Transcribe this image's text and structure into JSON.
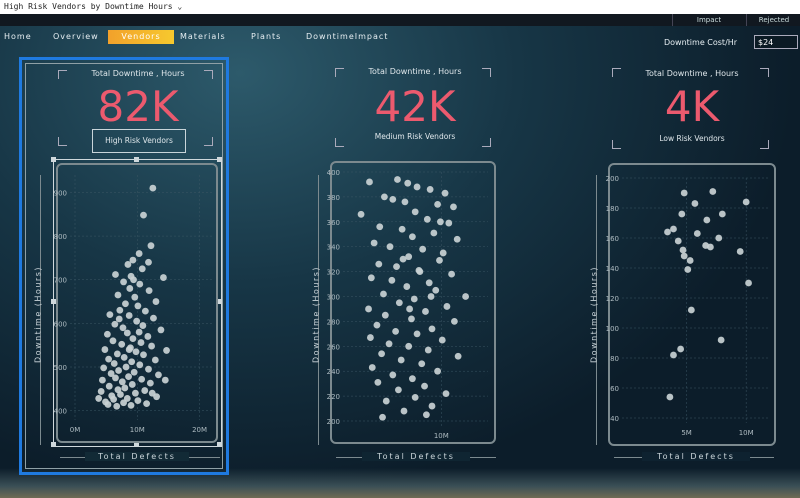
{
  "window": {
    "title": "High Risk Vendors by Downtime Hours",
    "tabs": [
      {
        "label": "Impact"
      },
      {
        "label": "Rejected"
      }
    ]
  },
  "nav": {
    "items": [
      {
        "label": "Home"
      },
      {
        "label": "Overview"
      },
      {
        "label": "Vendors"
      },
      {
        "label": "Materials"
      },
      {
        "label": "Plants"
      },
      {
        "label": "DowntimeImpact"
      }
    ],
    "active": "Vendors"
  },
  "cost": {
    "label": "Downtime Cost/Hr",
    "value": "$24"
  },
  "kpis": [
    {
      "title": "Total Downtime , Hours",
      "value": "82K",
      "subtitle": "High Risk Vendors"
    },
    {
      "title": "Total Downtime , Hours",
      "value": "42K",
      "subtitle": "Medium Risk Vendors"
    },
    {
      "title": "Total Downtime , Hours",
      "value": "4K",
      "subtitle": "Low Risk Vendors"
    }
  ],
  "colors": {
    "accent_nav": "#f2a12b",
    "kpi_value": "#ec5a6e",
    "selection": "#1f7ae0",
    "points": "#c9d1d4"
  },
  "chart_data": [
    {
      "type": "scatter",
      "title": "",
      "xlabel": "Total Defects",
      "ylabel": "Downtime (Hours)",
      "xlim": [
        0,
        22000000
      ],
      "ylim": [
        390,
        940
      ],
      "xticks": [
        "0M",
        "10M",
        "20M"
      ],
      "yticks": [
        "400",
        "500",
        "600",
        "700",
        "800",
        "900"
      ],
      "points": [
        [
          12500000,
          910
        ],
        [
          11000000,
          848
        ],
        [
          12200000,
          778
        ],
        [
          10300000,
          760
        ],
        [
          9300000,
          745
        ],
        [
          8500000,
          735
        ],
        [
          10800000,
          725
        ],
        [
          6500000,
          712
        ],
        [
          9000000,
          708
        ],
        [
          14200000,
          705
        ],
        [
          7800000,
          695
        ],
        [
          10400000,
          690
        ],
        [
          8800000,
          680
        ],
        [
          11900000,
          675
        ],
        [
          6900000,
          665
        ],
        [
          9600000,
          660
        ],
        [
          13000000,
          650
        ],
        [
          8100000,
          645
        ],
        [
          10100000,
          640
        ],
        [
          7200000,
          630
        ],
        [
          11300000,
          628
        ],
        [
          5600000,
          620
        ],
        [
          8700000,
          618
        ],
        [
          12600000,
          612
        ],
        [
          9900000,
          605
        ],
        [
          6400000,
          598
        ],
        [
          10900000,
          595
        ],
        [
          7700000,
          590
        ],
        [
          13800000,
          585
        ],
        [
          8400000,
          578
        ],
        [
          5200000,
          575
        ],
        [
          11700000,
          570
        ],
        [
          9300000,
          565
        ],
        [
          6100000,
          560
        ],
        [
          10600000,
          556
        ],
        [
          7500000,
          552
        ],
        [
          12300000,
          548
        ],
        [
          8900000,
          544
        ],
        [
          4800000,
          540
        ],
        [
          14700000,
          538
        ],
        [
          9800000,
          535
        ],
        [
          6800000,
          530
        ],
        [
          11000000,
          528
        ],
        [
          7900000,
          522
        ],
        [
          5400000,
          518
        ],
        [
          12900000,
          516
        ],
        [
          9100000,
          512
        ],
        [
          6300000,
          508
        ],
        [
          10400000,
          505
        ],
        [
          8200000,
          500
        ],
        [
          4600000,
          498
        ],
        [
          11800000,
          495
        ],
        [
          7000000,
          492
        ],
        [
          9500000,
          488
        ],
        [
          5800000,
          485
        ],
        [
          13400000,
          482
        ],
        [
          8600000,
          478
        ],
        [
          6500000,
          475
        ],
        [
          10700000,
          472
        ],
        [
          4400000,
          470
        ],
        [
          7600000,
          466
        ],
        [
          12100000,
          463
        ],
        [
          9200000,
          460
        ],
        [
          5500000,
          456
        ],
        [
          8000000,
          452
        ],
        [
          6900000,
          448
        ],
        [
          11200000,
          446
        ],
        [
          4200000,
          444
        ],
        [
          9700000,
          440
        ],
        [
          7300000,
          437
        ],
        [
          5900000,
          434
        ],
        [
          13100000,
          432
        ],
        [
          8400000,
          428
        ],
        [
          6200000,
          426
        ],
        [
          10100000,
          423
        ],
        [
          4900000,
          420
        ],
        [
          7800000,
          418
        ],
        [
          11500000,
          416
        ],
        [
          5300000,
          414
        ],
        [
          9000000,
          412
        ],
        [
          6700000,
          410
        ],
        [
          3800000,
          428
        ],
        [
          12400000,
          440
        ],
        [
          14500000,
          470
        ],
        [
          8700000,
          540
        ],
        [
          10300000,
          580
        ],
        [
          7100000,
          610
        ],
        [
          9400000,
          700
        ],
        [
          11800000,
          740
        ]
      ]
    },
    {
      "type": "scatter",
      "title": "",
      "xlabel": "Total Defects",
      "ylabel": "Downtime (Hours)",
      "xlim": [
        0,
        15000000
      ],
      "ylim": [
        200,
        400
      ],
      "xticks": [
        "10M"
      ],
      "yticks": [
        "200",
        "220",
        "240",
        "260",
        "280",
        "300",
        "320",
        "340",
        "360",
        "380",
        "400"
      ],
      "points": [
        [
          2300000,
          392
        ],
        [
          5300000,
          394
        ],
        [
          6400000,
          391
        ],
        [
          7400000,
          388
        ],
        [
          8800000,
          386
        ],
        [
          10400000,
          383
        ],
        [
          3900000,
          380
        ],
        [
          4800000,
          378
        ],
        [
          6100000,
          376
        ],
        [
          9600000,
          374
        ],
        [
          11300000,
          372
        ],
        [
          1400000,
          366
        ],
        [
          7200000,
          368
        ],
        [
          8500000,
          362
        ],
        [
          10800000,
          359
        ],
        [
          3400000,
          356
        ],
        [
          5800000,
          354
        ],
        [
          9200000,
          351
        ],
        [
          6900000,
          348
        ],
        [
          11700000,
          346
        ],
        [
          2800000,
          343
        ],
        [
          4500000,
          340
        ],
        [
          8000000,
          338
        ],
        [
          10200000,
          335
        ],
        [
          6500000,
          332
        ],
        [
          9800000,
          329
        ],
        [
          3300000,
          326
        ],
        [
          5200000,
          324
        ],
        [
          7600000,
          321
        ],
        [
          11100000,
          318
        ],
        [
          2500000,
          315
        ],
        [
          4700000,
          313
        ],
        [
          8700000,
          311
        ],
        [
          6300000,
          308
        ],
        [
          9400000,
          305
        ],
        [
          3800000,
          302
        ],
        [
          12600000,
          300
        ],
        [
          7100000,
          298
        ],
        [
          5500000,
          295
        ],
        [
          10600000,
          292
        ],
        [
          2200000,
          290
        ],
        [
          8300000,
          288
        ],
        [
          4000000,
          285
        ],
        [
          6800000,
          282
        ],
        [
          11400000,
          280
        ],
        [
          3100000,
          277
        ],
        [
          9000000,
          274
        ],
        [
          5100000,
          272
        ],
        [
          7400000,
          270
        ],
        [
          2400000,
          267
        ],
        [
          10100000,
          265
        ],
        [
          4400000,
          262
        ],
        [
          6500000,
          260
        ],
        [
          8600000,
          257
        ],
        [
          3600000,
          254
        ],
        [
          11800000,
          252
        ],
        [
          5700000,
          249
        ],
        [
          7900000,
          246
        ],
        [
          2600000,
          243
        ],
        [
          9600000,
          240
        ],
        [
          4800000,
          237
        ],
        [
          6900000,
          234
        ],
        [
          3200000,
          231
        ],
        [
          8200000,
          228
        ],
        [
          5400000,
          225
        ],
        [
          10500000,
          222
        ],
        [
          7200000,
          219
        ],
        [
          4100000,
          216
        ],
        [
          9000000,
          212
        ],
        [
          6000000,
          208
        ],
        [
          8400000,
          205
        ],
        [
          3700000,
          203
        ],
        [
          7700000,
          320
        ],
        [
          9900000,
          360
        ],
        [
          5900000,
          330
        ],
        [
          8900000,
          300
        ],
        [
          6600000,
          290
        ]
      ]
    },
    {
      "type": "scatter",
      "title": "",
      "xlabel": "Total Defects",
      "ylabel": "Downtime (Hours)",
      "xlim": [
        0,
        12000000
      ],
      "ylim": [
        40,
        200
      ],
      "xticks": [
        "5M",
        "10M"
      ],
      "yticks": [
        "40",
        "60",
        "80",
        "100",
        "120",
        "140",
        "160",
        "180",
        "200"
      ],
      "points": [
        [
          4800000,
          190
        ],
        [
          7200000,
          191
        ],
        [
          5700000,
          183
        ],
        [
          8000000,
          176
        ],
        [
          10000000,
          184
        ],
        [
          3900000,
          166
        ],
        [
          4600000,
          176
        ],
        [
          6700000,
          172
        ],
        [
          3400000,
          164
        ],
        [
          5900000,
          163
        ],
        [
          4300000,
          158
        ],
        [
          7700000,
          160
        ],
        [
          6600000,
          155
        ],
        [
          9500000,
          151
        ],
        [
          4700000,
          152
        ],
        [
          5300000,
          145
        ],
        [
          5100000,
          139
        ],
        [
          10200000,
          130
        ],
        [
          5400000,
          112
        ],
        [
          7900000,
          92
        ],
        [
          4500000,
          86
        ],
        [
          3900000,
          82
        ],
        [
          3600000,
          54
        ],
        [
          7000000,
          154
        ],
        [
          4800000,
          148
        ]
      ]
    }
  ]
}
